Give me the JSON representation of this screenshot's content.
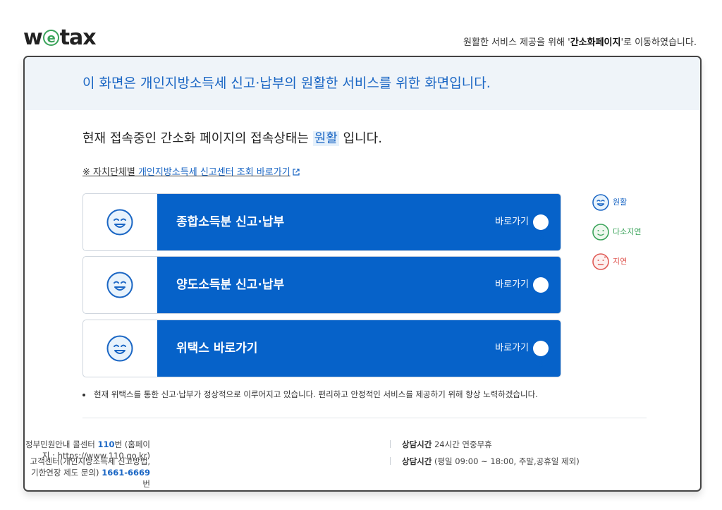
{
  "header": {
    "logo_pre": "w",
    "logo_e": "e",
    "logo_post": "tax",
    "redirect_pre": "원활한 서비스 제공을 위해 '",
    "redirect_bold": "간소화페이지",
    "redirect_post": "'로 이동하였습니다."
  },
  "banner": {
    "text": "이 화면은 개인지방소득세 신고·납부의 원활한 서비스를 위한 화면입니다."
  },
  "status": {
    "pre": "현재 접속중인 간소화 페이지의 접속상태는 ",
    "value": "원활",
    "post": " 입니다."
  },
  "local_link": {
    "prefix": "※ 자치단체별 ",
    "link": "개인지방소득세 신고센터 조회 바로가기"
  },
  "cards": [
    {
      "title": "종합소득분 신고·납부",
      "go_label": "바로가기"
    },
    {
      "title": "양도소득분 신고·납부",
      "go_label": "바로가기"
    },
    {
      "title": "위택스 바로가기",
      "go_label": "바로가기"
    }
  ],
  "legend": [
    {
      "label": "원활",
      "color": "#1a66c4"
    },
    {
      "label": "다소지연",
      "color": "#3aa35a"
    },
    {
      "label": "지연",
      "color": "#e05a55"
    }
  ],
  "notice": {
    "text": "현재 위택스를 통한 신고·납부가 정상적으로 이루어지고 있습니다. 편리하고 안정적인 서비스를 제공하기 위해 항상 노력하겠습니다."
  },
  "footer": {
    "row1_left_pre": "정부민원안내 콜센터 ",
    "row1_left_num": "110",
    "row1_left_post": "번 (홈페이지 : https://www.110.go.kr)",
    "row1_right_label": "상담시간",
    "row1_right_value": " 24시간 연중무휴",
    "row2_left_pre": "고객센터(개인지방소득세 신고방법, 기한연장 제도 문의) ",
    "row2_left_num": "1661-6669",
    "row2_left_post": "번",
    "row2_right_label": "상담시간",
    "row2_right_value": " (평일 09:00 ~ 18:00, 주말,공휴일 제외)"
  }
}
